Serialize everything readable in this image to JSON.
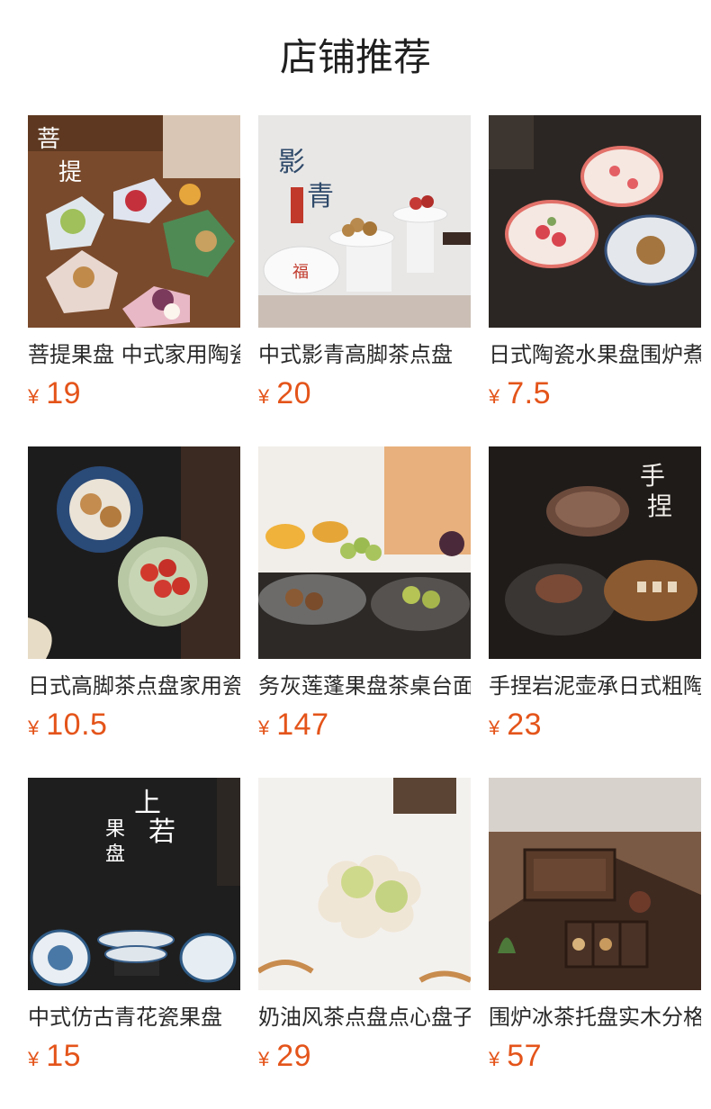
{
  "header": {
    "title": "店铺推荐"
  },
  "currency": "¥",
  "colors": {
    "price": "#e4541a",
    "title": "#1f1f1f"
  },
  "products": [
    {
      "name": "菩提果盘 中式家用陶瓷果盘",
      "price": "19",
      "image": "bodhi-fruit-plate-photo"
    },
    {
      "name": "中式影青高脚茶点盘",
      "price": "20",
      "image": "celadon-high-foot-plate-photo"
    },
    {
      "name": "日式陶瓷水果盘围炉煮茶",
      "price": "7.5",
      "image": "japanese-ceramic-bowls-photo"
    },
    {
      "name": "日式高脚茶点盘家用瓷盘",
      "price": "10.5",
      "image": "flower-plates-tomatoes-photo"
    },
    {
      "name": "务灰莲蓬果盘茶桌台面",
      "price": "147",
      "image": "lotus-fruit-tray-photo"
    },
    {
      "name": "手捏岩泥壶承日式粗陶",
      "price": "23",
      "image": "rock-clay-teapot-tray-photo"
    },
    {
      "name": "中式仿古青花瓷果盘",
      "price": "15",
      "image": "blue-white-porcelain-photo"
    },
    {
      "name": "奶油风茶点盘点心盘子",
      "price": "29",
      "image": "cream-cloud-plate-photo"
    },
    {
      "name": "围炉冰茶托盘实木分格",
      "price": "57",
      "image": "wooden-tea-tray-photo"
    }
  ]
}
